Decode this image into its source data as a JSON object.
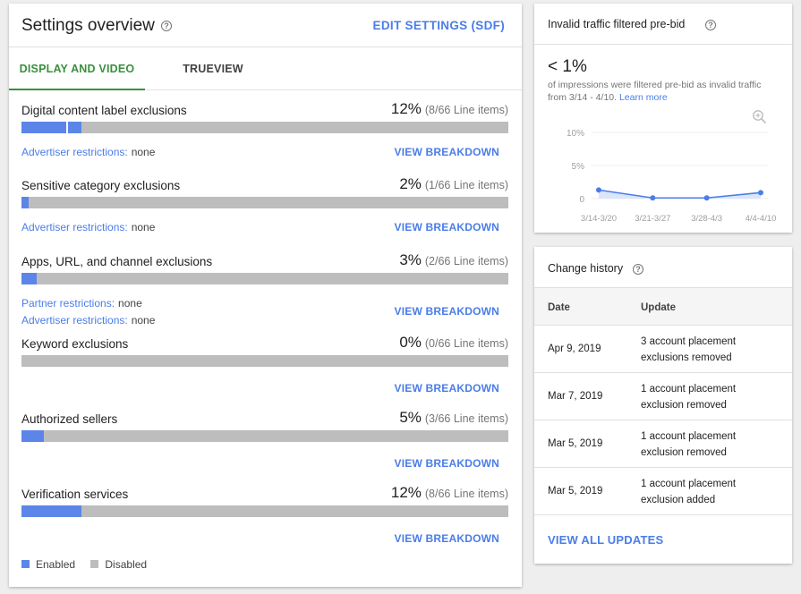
{
  "settings": {
    "title": "Settings overview",
    "help_icon": "?",
    "edit_label": "EDIT SETTINGS (SDF)",
    "tabs": [
      {
        "label": "DISPLAY AND VIDEO",
        "active": true
      },
      {
        "label": "TRUEVIEW",
        "active": false
      }
    ],
    "rows": [
      {
        "label": "Digital content label exclusions",
        "pct": "12%",
        "count": "(8/66 Line items)",
        "fill": 0.123,
        "divider": 0.092,
        "restrictions": [
          {
            "label": "Advertiser restrictions:",
            "value": "none"
          }
        ],
        "breakdown": "VIEW BREAKDOWN"
      },
      {
        "label": "Sensitive category exclusions",
        "pct": "2%",
        "count": "(1/66 Line items)",
        "fill": 0.015,
        "restrictions": [
          {
            "label": "Advertiser restrictions:",
            "value": "none"
          }
        ],
        "breakdown": "VIEW BREAKDOWN"
      },
      {
        "label": "Apps, URL, and channel exclusions",
        "pct": "3%",
        "count": "(2/66 Line items)",
        "fill": 0.031,
        "restrictions": [
          {
            "label": "Partner restrictions:",
            "value": "none"
          },
          {
            "label": "Advertiser restrictions:",
            "value": "none"
          }
        ],
        "breakdown": "VIEW BREAKDOWN"
      },
      {
        "label": "Keyword exclusions",
        "pct": "0%",
        "count": "(0/66 Line items)",
        "fill": 0,
        "restrictions": [],
        "breakdown": "VIEW BREAKDOWN"
      },
      {
        "label": "Authorized sellers",
        "pct": "5%",
        "count": "(3/66 Line items)",
        "fill": 0.046,
        "restrictions": [],
        "breakdown": "VIEW BREAKDOWN"
      },
      {
        "label": "Verification services",
        "pct": "12%",
        "count": "(8/66 Line items)",
        "fill": 0.123,
        "restrictions": [],
        "breakdown": "VIEW BREAKDOWN"
      }
    ],
    "legend": [
      {
        "label": "Enabled",
        "color": "#5b85e8"
      },
      {
        "label": "Disabled",
        "color": "#bdbdbd"
      }
    ]
  },
  "invalid_traffic": {
    "title": "Invalid traffic filtered pre-bid",
    "value": "< 1%",
    "description": "of impressions were filtered pre-bid as invalid traffic from 3/14 - 4/10.",
    "learn_more": "Learn more",
    "zoom_icon": "zoom-in-icon",
    "chart_data": {
      "type": "area",
      "categories": [
        "3/14-3/20",
        "3/21-3/27",
        "3/28-4/3",
        "4/4-4/10"
      ],
      "values": [
        1.3,
        0.1,
        0.1,
        0.9
      ],
      "y_ticks": [
        "10%",
        "5%",
        "0"
      ],
      "ylim": [
        0,
        10
      ],
      "color": "#4a7de8"
    }
  },
  "change_history": {
    "title": "Change history",
    "columns": [
      "Date",
      "Update"
    ],
    "rows": [
      {
        "date": "Apr 9, 2019",
        "update": "3 account placement exclusions removed"
      },
      {
        "date": "Mar 7, 2019",
        "update": "1 account placement exclusion removed"
      },
      {
        "date": "Mar 5, 2019",
        "update": "1 account placement exclusion removed"
      },
      {
        "date": "Mar 5, 2019",
        "update": "1 account placement exclusion added"
      }
    ],
    "view_all": "VIEW ALL UPDATES"
  }
}
